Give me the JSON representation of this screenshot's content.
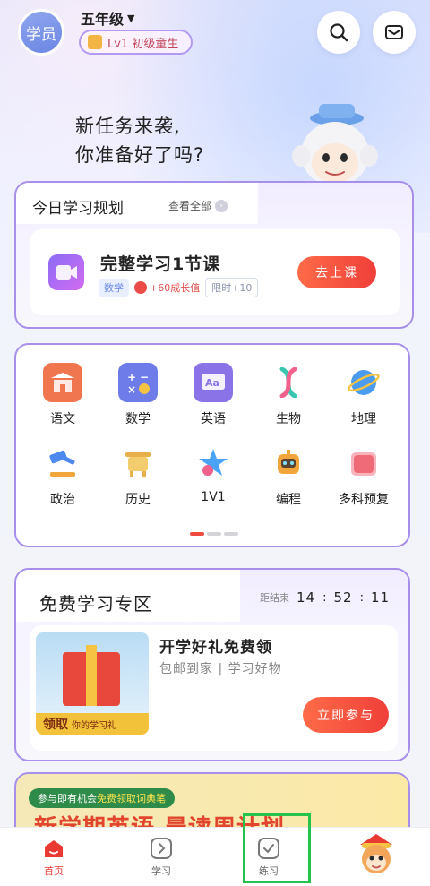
{
  "header": {
    "avatar_label": "学员",
    "grade": "五年级",
    "level_badge": "Lv1 初级童生"
  },
  "hero": {
    "line1": "新任务来袭,",
    "line2": "你准备好了吗?"
  },
  "plan": {
    "title": "今日学习规划",
    "view_all": "查看全部",
    "course_title": "完整学习1节课",
    "subject_tag": "数学",
    "growth": "+60成长值",
    "limit": "限时+10",
    "button": "去上课"
  },
  "subjects": [
    {
      "label": "语文",
      "icon": "chinese-icon",
      "color": "#f0764f"
    },
    {
      "label": "数学",
      "icon": "math-icon",
      "color": "#6d7ce9"
    },
    {
      "label": "英语",
      "icon": "english-icon",
      "color": "#8a73e6"
    },
    {
      "label": "生物",
      "icon": "biology-icon",
      "color": "#39c6b0"
    },
    {
      "label": "地理",
      "icon": "geography-icon",
      "color": "#4b9bf0"
    },
    {
      "label": "政治",
      "icon": "politics-icon",
      "color": "#4d89ef"
    },
    {
      "label": "历史",
      "icon": "history-icon",
      "color": "#e7b04a"
    },
    {
      "label": "1V1",
      "icon": "tutor-icon",
      "color": "#4aa3f4"
    },
    {
      "label": "编程",
      "icon": "coding-icon",
      "color": "#f2a53a"
    },
    {
      "label": "多科预复",
      "icon": "multi-subject-icon",
      "color": "#f06b78"
    }
  ],
  "free_zone": {
    "title": "免费学习专区",
    "countdown_label": "距结束",
    "hours": "14",
    "minutes": "52",
    "seconds": "11",
    "gift_band_big": "领取",
    "gift_band_small": "你的学习礼",
    "gift_title": "开学好礼免费领",
    "gift_sub": "包邮到家 | 学习好物",
    "button": "立即参与"
  },
  "banner": {
    "pill_prefix": "参与即有机会",
    "pill_highlight": "免费领取词典笔",
    "headline": "新学期英语 晨读周计划"
  },
  "nav": {
    "home": "首页",
    "study": "学习",
    "practice": "练习"
  },
  "colors": {
    "accent_red": "#ef3f39",
    "accent_purple": "#a890ea",
    "highlight_green": "#27c24c"
  }
}
